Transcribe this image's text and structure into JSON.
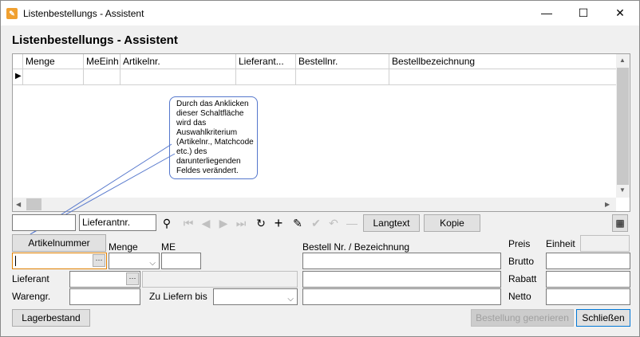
{
  "window": {
    "title": "Listenbestellungs - Assistent",
    "icon": "wizard-app-icon",
    "buttons": {
      "minimize": "—",
      "maximize": "☐",
      "close": "✕"
    }
  },
  "heading": "Listenbestellungs - Assistent",
  "grid": {
    "columns": [
      "Menge",
      "MeEinh",
      "Artikelnr.",
      "Lieferant...",
      "Bestellnr.",
      "Bestellbezeichnung"
    ]
  },
  "callout": {
    "text": "Durch das Anklicken dieser Schaltfläche wird das Auswahlkriterium (Artikelnr., Matchcode etc.) des darunterliegenden Feldes verändert."
  },
  "toolbar": {
    "search_value": "",
    "lieferantnr_label": "Lieferantnr.",
    "langtext_label": "Langtext",
    "kopie_label": "Kopie",
    "icons": [
      "search-icon",
      "first-record-icon",
      "prev-record-icon",
      "next-record-icon",
      "last-record-icon",
      "refresh-icon",
      "add-icon",
      "edit-icon",
      "confirm-icon",
      "undo-icon",
      "delete-icon"
    ],
    "calculator_icon": "calculator-icon"
  },
  "form": {
    "artikelnummer_button": "Artikelnummer",
    "menge_label": "Menge",
    "me_label": "ME",
    "bestell_label": "Bestell Nr. / Bezeichnung",
    "preis_label": "Preis",
    "einheit_label": "Einheit",
    "brutto_label": "Brutto",
    "rabatt_label": "Rabatt",
    "netto_label": "Netto",
    "lieferant_label": "Lieferant",
    "warengr_label": "Warengr.",
    "zuliefern_label": "Zu Liefern bis",
    "ellipsis": "···"
  },
  "buttons": {
    "lagerbestand": "Lagerbestand",
    "bestellung_generieren": "Bestellung generieren",
    "schliessen": "Schließen"
  }
}
